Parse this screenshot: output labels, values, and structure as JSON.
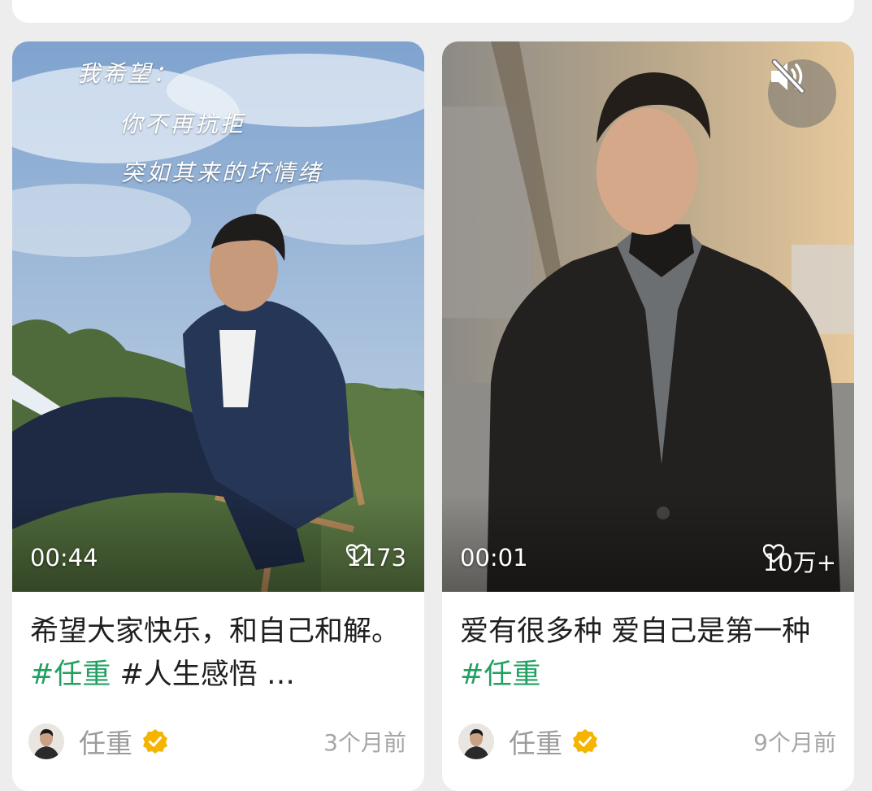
{
  "cards": [
    {
      "overlay_lines": [
        "我希望：",
        "你不再抗拒",
        "突如其来的坏情绪"
      ],
      "duration": "00:44",
      "likes": "1173",
      "title_text": "希望大家快乐，和自己和解。",
      "tags": [
        "#任重",
        "#人生感悟"
      ],
      "ellipsis": "…",
      "author": "任重",
      "time": "3个月前"
    },
    {
      "duration": "00:01",
      "likes": "10万+",
      "title_text": "爱有很多种 爱自己是第一种",
      "tags": [
        "#任重"
      ],
      "author": "任重",
      "time": "9个月前",
      "muted": true
    }
  ],
  "colors": {
    "tag": "#22a062",
    "verified": "#f5b400",
    "background": "#ededed"
  },
  "icons": [
    "heart-outline-icon",
    "mute-speaker-icon",
    "verified-badge-icon"
  ]
}
